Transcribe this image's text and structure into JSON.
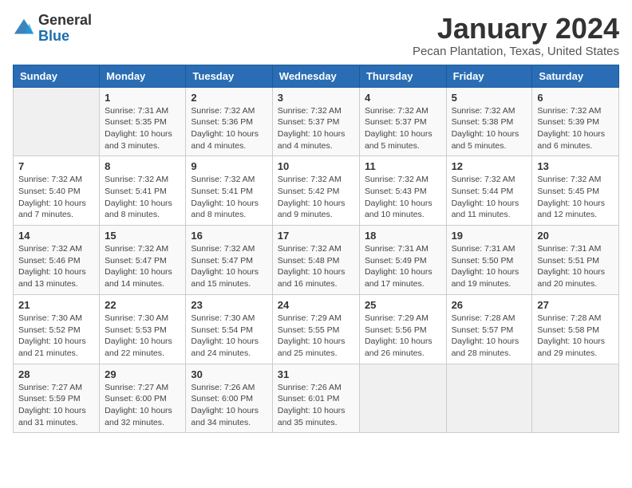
{
  "logo": {
    "general": "General",
    "blue": "Blue"
  },
  "title": "January 2024",
  "subtitle": "Pecan Plantation, Texas, United States",
  "headers": [
    "Sunday",
    "Monday",
    "Tuesday",
    "Wednesday",
    "Thursday",
    "Friday",
    "Saturday"
  ],
  "weeks": [
    [
      {
        "day": "",
        "info": ""
      },
      {
        "day": "1",
        "info": "Sunrise: 7:31 AM\nSunset: 5:35 PM\nDaylight: 10 hours\nand 3 minutes."
      },
      {
        "day": "2",
        "info": "Sunrise: 7:32 AM\nSunset: 5:36 PM\nDaylight: 10 hours\nand 4 minutes."
      },
      {
        "day": "3",
        "info": "Sunrise: 7:32 AM\nSunset: 5:37 PM\nDaylight: 10 hours\nand 4 minutes."
      },
      {
        "day": "4",
        "info": "Sunrise: 7:32 AM\nSunset: 5:37 PM\nDaylight: 10 hours\nand 5 minutes."
      },
      {
        "day": "5",
        "info": "Sunrise: 7:32 AM\nSunset: 5:38 PM\nDaylight: 10 hours\nand 5 minutes."
      },
      {
        "day": "6",
        "info": "Sunrise: 7:32 AM\nSunset: 5:39 PM\nDaylight: 10 hours\nand 6 minutes."
      }
    ],
    [
      {
        "day": "7",
        "info": "Sunrise: 7:32 AM\nSunset: 5:40 PM\nDaylight: 10 hours\nand 7 minutes."
      },
      {
        "day": "8",
        "info": "Sunrise: 7:32 AM\nSunset: 5:41 PM\nDaylight: 10 hours\nand 8 minutes."
      },
      {
        "day": "9",
        "info": "Sunrise: 7:32 AM\nSunset: 5:41 PM\nDaylight: 10 hours\nand 8 minutes."
      },
      {
        "day": "10",
        "info": "Sunrise: 7:32 AM\nSunset: 5:42 PM\nDaylight: 10 hours\nand 9 minutes."
      },
      {
        "day": "11",
        "info": "Sunrise: 7:32 AM\nSunset: 5:43 PM\nDaylight: 10 hours\nand 10 minutes."
      },
      {
        "day": "12",
        "info": "Sunrise: 7:32 AM\nSunset: 5:44 PM\nDaylight: 10 hours\nand 11 minutes."
      },
      {
        "day": "13",
        "info": "Sunrise: 7:32 AM\nSunset: 5:45 PM\nDaylight: 10 hours\nand 12 minutes."
      }
    ],
    [
      {
        "day": "14",
        "info": "Sunrise: 7:32 AM\nSunset: 5:46 PM\nDaylight: 10 hours\nand 13 minutes."
      },
      {
        "day": "15",
        "info": "Sunrise: 7:32 AM\nSunset: 5:47 PM\nDaylight: 10 hours\nand 14 minutes."
      },
      {
        "day": "16",
        "info": "Sunrise: 7:32 AM\nSunset: 5:47 PM\nDaylight: 10 hours\nand 15 minutes."
      },
      {
        "day": "17",
        "info": "Sunrise: 7:32 AM\nSunset: 5:48 PM\nDaylight: 10 hours\nand 16 minutes."
      },
      {
        "day": "18",
        "info": "Sunrise: 7:31 AM\nSunset: 5:49 PM\nDaylight: 10 hours\nand 17 minutes."
      },
      {
        "day": "19",
        "info": "Sunrise: 7:31 AM\nSunset: 5:50 PM\nDaylight: 10 hours\nand 19 minutes."
      },
      {
        "day": "20",
        "info": "Sunrise: 7:31 AM\nSunset: 5:51 PM\nDaylight: 10 hours\nand 20 minutes."
      }
    ],
    [
      {
        "day": "21",
        "info": "Sunrise: 7:30 AM\nSunset: 5:52 PM\nDaylight: 10 hours\nand 21 minutes."
      },
      {
        "day": "22",
        "info": "Sunrise: 7:30 AM\nSunset: 5:53 PM\nDaylight: 10 hours\nand 22 minutes."
      },
      {
        "day": "23",
        "info": "Sunrise: 7:30 AM\nSunset: 5:54 PM\nDaylight: 10 hours\nand 24 minutes."
      },
      {
        "day": "24",
        "info": "Sunrise: 7:29 AM\nSunset: 5:55 PM\nDaylight: 10 hours\nand 25 minutes."
      },
      {
        "day": "25",
        "info": "Sunrise: 7:29 AM\nSunset: 5:56 PM\nDaylight: 10 hours\nand 26 minutes."
      },
      {
        "day": "26",
        "info": "Sunrise: 7:28 AM\nSunset: 5:57 PM\nDaylight: 10 hours\nand 28 minutes."
      },
      {
        "day": "27",
        "info": "Sunrise: 7:28 AM\nSunset: 5:58 PM\nDaylight: 10 hours\nand 29 minutes."
      }
    ],
    [
      {
        "day": "28",
        "info": "Sunrise: 7:27 AM\nSunset: 5:59 PM\nDaylight: 10 hours\nand 31 minutes."
      },
      {
        "day": "29",
        "info": "Sunrise: 7:27 AM\nSunset: 6:00 PM\nDaylight: 10 hours\nand 32 minutes."
      },
      {
        "day": "30",
        "info": "Sunrise: 7:26 AM\nSunset: 6:00 PM\nDaylight: 10 hours\nand 34 minutes."
      },
      {
        "day": "31",
        "info": "Sunrise: 7:26 AM\nSunset: 6:01 PM\nDaylight: 10 hours\nand 35 minutes."
      },
      {
        "day": "",
        "info": ""
      },
      {
        "day": "",
        "info": ""
      },
      {
        "day": "",
        "info": ""
      }
    ]
  ]
}
